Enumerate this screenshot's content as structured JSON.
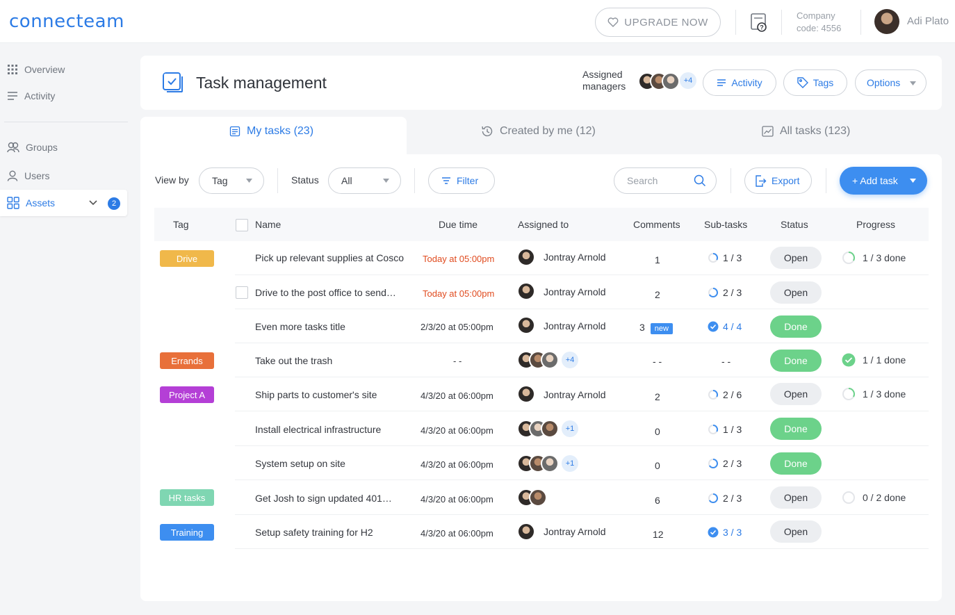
{
  "brand": {
    "logo": "connecteam"
  },
  "topbar": {
    "upgrade_label": "UPGRADE NOW",
    "company_label": "Company",
    "company_code": "code: 4556",
    "user_name": "Adi Plato"
  },
  "sidebar": {
    "items": [
      {
        "label": "Overview"
      },
      {
        "label": "Activity"
      },
      {
        "label": "Groups"
      },
      {
        "label": "Users"
      },
      {
        "label": "Assets",
        "badge": "2"
      }
    ]
  },
  "header": {
    "title": "Task management",
    "managers_label_1": "Assigned",
    "managers_label_2": "managers",
    "managers_more": "+4",
    "activity_label": "Activity",
    "tags_label": "Tags",
    "options_label": "Options"
  },
  "tabs": [
    {
      "label": "My tasks (23)"
    },
    {
      "label": "Created by me (12)"
    },
    {
      "label": "All tasks (123)"
    }
  ],
  "toolbar": {
    "view_by_label": "View by",
    "view_by_value": "Tag",
    "status_label": "Status",
    "status_value": "All",
    "filter_label": "Filter",
    "search_placeholder": "Search",
    "export_label": "Export",
    "add_task_label": "+ Add task"
  },
  "table": {
    "headers": {
      "tag": "Tag",
      "name": "Name",
      "due": "Due time",
      "assigned": "Assigned to",
      "comments": "Comments",
      "subtasks": "Sub-tasks",
      "status": "Status",
      "progress": "Progress"
    },
    "tags": [
      {
        "label": "Drive",
        "color": "#f0b84a"
      },
      {
        "label": "Errands",
        "color": "#e8703a"
      },
      {
        "label": "Project A",
        "color": "#b43fd6"
      },
      {
        "label": "HR tasks",
        "color": "#7fd6b2"
      },
      {
        "label": "Training",
        "color": "#3d8ef0"
      }
    ],
    "rows": [
      {
        "name": "Pick up relevant supplies at Cosco",
        "due": "Today at 05:00pm",
        "assignee": "Jontray Arnold",
        "comments": "1",
        "subtasks": "1 / 3",
        "status": "Open",
        "progress": "1 / 3 done"
      },
      {
        "name": "Drive to the post office to send…",
        "due": "Today at 05:00pm",
        "assignee": "Jontray Arnold",
        "comments": "2",
        "subtasks": "2 / 3",
        "status": "Open"
      },
      {
        "name": "Even more tasks title",
        "due": "2/3/20 at 05:00pm",
        "assignee": "Jontray Arnold",
        "comments": "3",
        "comments_badge": "new",
        "subtasks": "4 / 4",
        "status": "Done"
      },
      {
        "name": "Take out the trash",
        "due": "- -",
        "assignee_more": "+4",
        "comments": "- -",
        "subtasks": "- -",
        "status": "Done",
        "progress": "1 / 1 done"
      },
      {
        "name": "Ship parts to customer's site",
        "due": "4/3/20 at 06:00pm",
        "assignee": "Jontray Arnold",
        "comments": "2",
        "subtasks": "2 / 6",
        "status": "Open",
        "progress": "1 / 3 done"
      },
      {
        "name": "Install electrical infrastructure",
        "due": "4/3/20 at 06:00pm",
        "assignee_more": "+1",
        "comments": "0",
        "subtasks": "1 / 3",
        "status": "Done"
      },
      {
        "name": "System setup on site",
        "due": "4/3/20 at 06:00pm",
        "assignee_more": "+1",
        "comments": "0",
        "subtasks": "2 / 3",
        "status": "Done"
      },
      {
        "name": "Get Josh to sign updated 401…",
        "due": "4/3/20 at 06:00pm",
        "comments": "6",
        "subtasks": "2 / 3",
        "status": "Open",
        "progress": "0 / 2 done"
      },
      {
        "name": "Setup safety training for H2",
        "due": "4/3/20 at 06:00pm",
        "assignee": "Jontray Arnold",
        "comments": "12",
        "subtasks": "3 / 3",
        "status": "Open"
      }
    ]
  }
}
